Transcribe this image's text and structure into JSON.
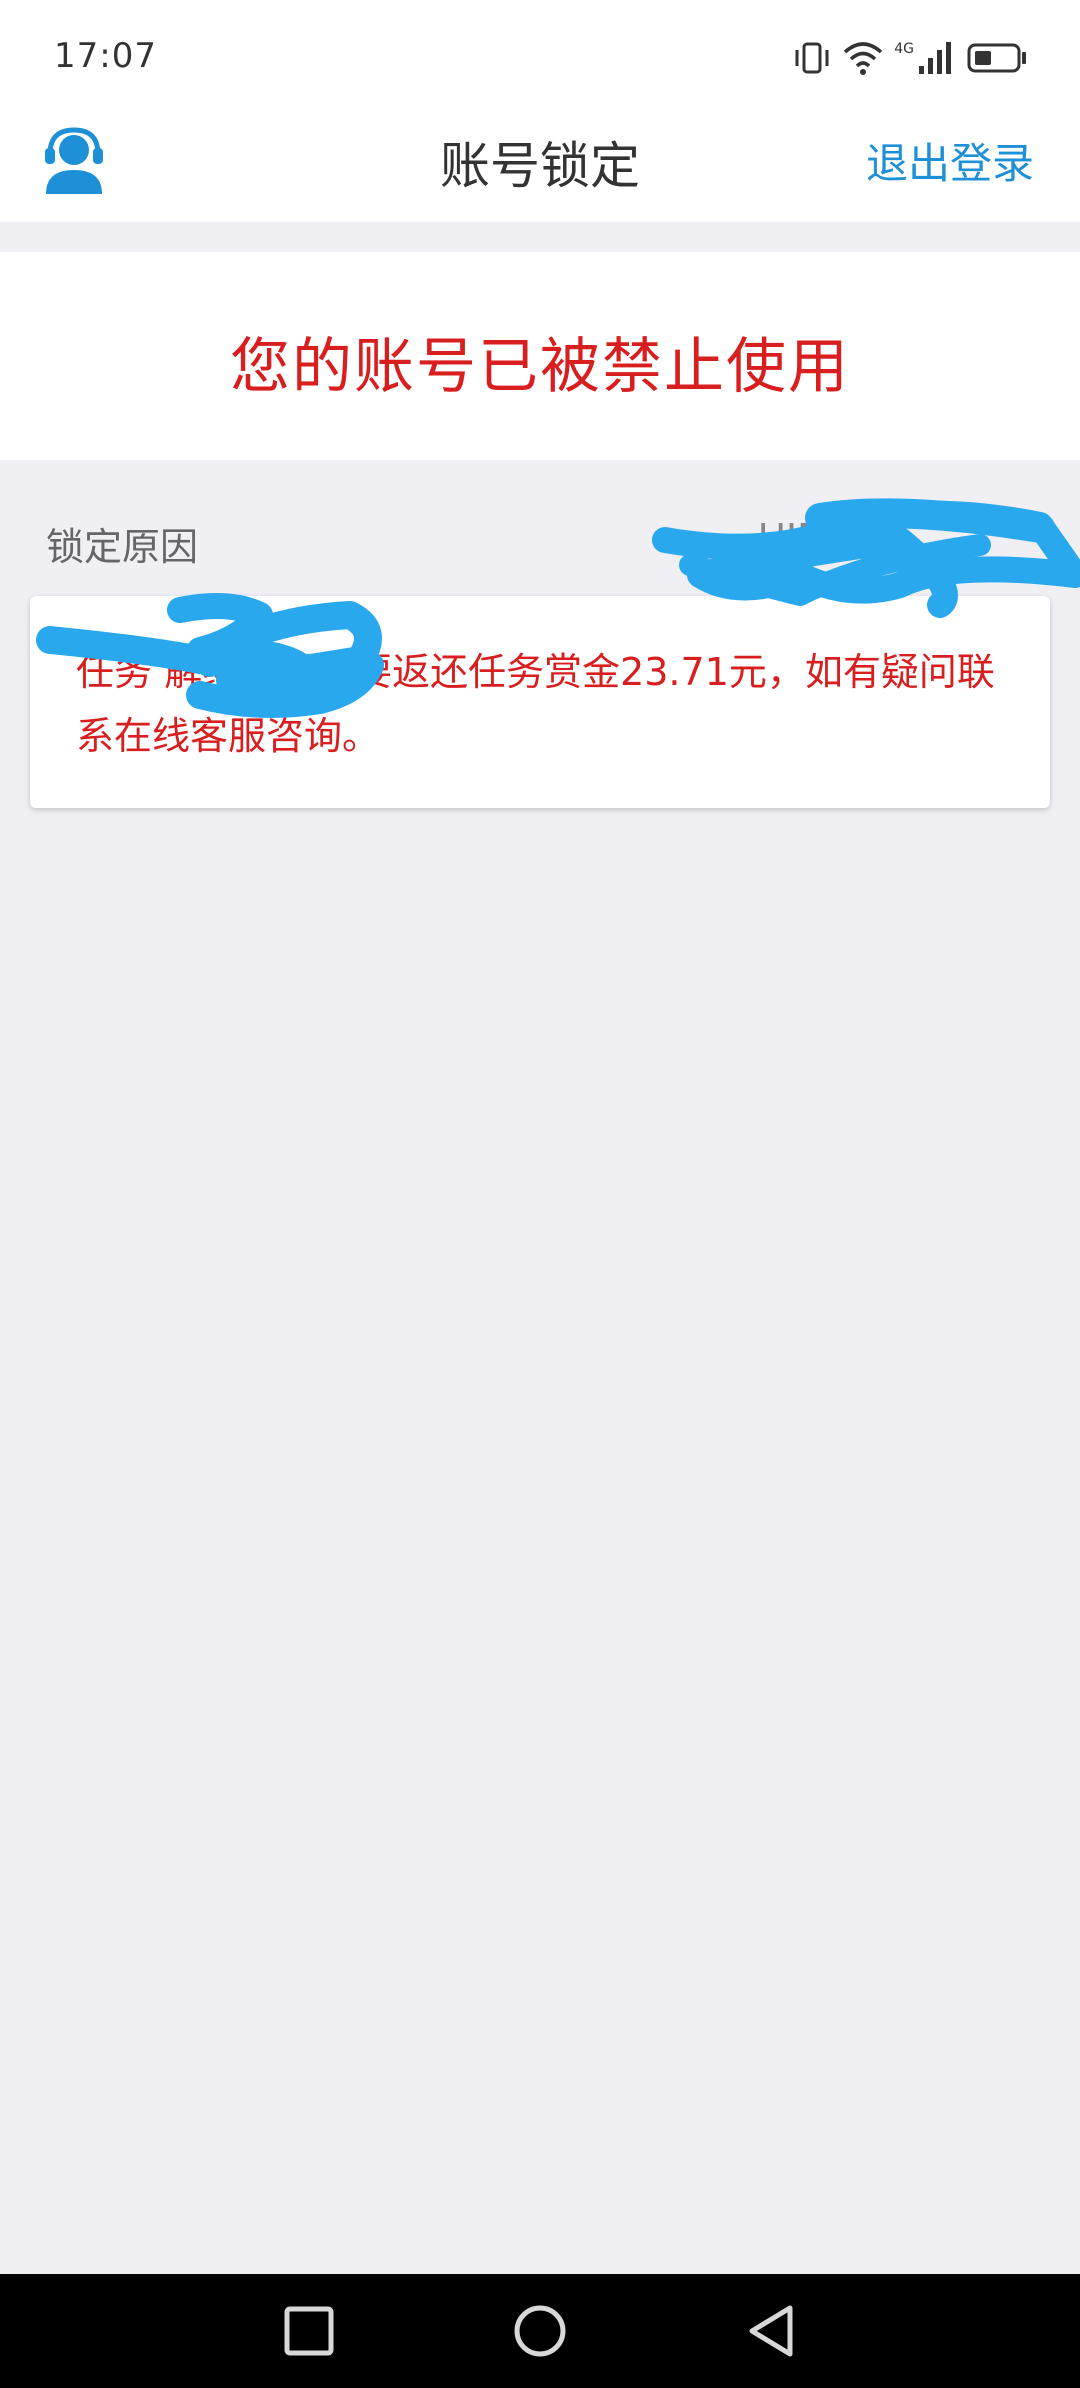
{
  "status_bar": {
    "time": "17:07",
    "network": "4G"
  },
  "header": {
    "title": "账号锁定",
    "logout_label": "退出登录",
    "support_icon": "customer-service-icon"
  },
  "banner": {
    "message": "您的账号已被禁止使用"
  },
  "lock_info": {
    "reason_label": "锁定原因",
    "uid_label": "UID",
    "reason_text": "任务 解绑，需要要返还任务赏金23.71元，如有疑问联系在线客服咨询。"
  },
  "bottom_nav": {
    "recent_icon": "square-icon",
    "home_icon": "circle-icon",
    "back_icon": "triangle-back-icon"
  },
  "colors": {
    "accent_blue": "#1e90d8",
    "alert_red": "#d81e1e",
    "page_bg": "#efeff4",
    "redaction": "#2aa8ee"
  }
}
